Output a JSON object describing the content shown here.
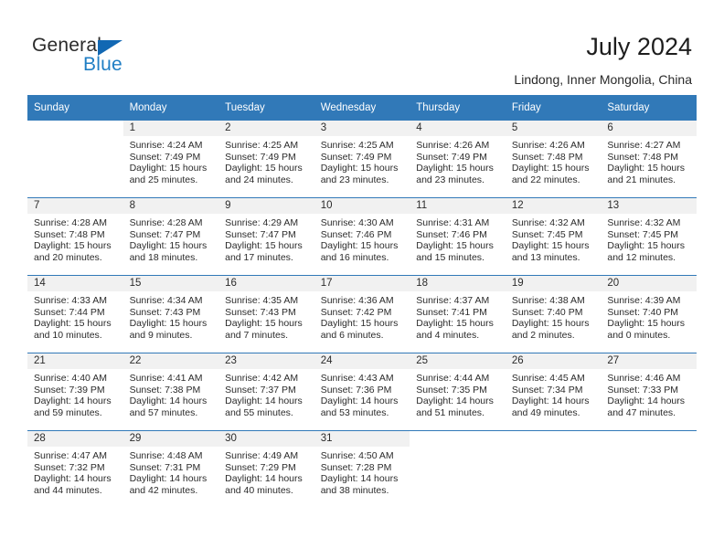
{
  "brand": {
    "name_part1": "General",
    "name_part2": "Blue",
    "triangle_color": "#1268b3",
    "blue_text_color": "#1f7ec4"
  },
  "header": {
    "title": "July 2024",
    "location": "Lindong, Inner Mongolia, China",
    "header_bg_color": "#3179b8"
  },
  "weekdays": [
    "Sunday",
    "Monday",
    "Tuesday",
    "Wednesday",
    "Thursday",
    "Friday",
    "Saturday"
  ],
  "labels": {
    "sunrise_prefix": "Sunrise:",
    "sunset_prefix": "Sunset:",
    "daylight_prefix": "Daylight:"
  },
  "weeks": [
    [
      {
        "day": "",
        "sunrise": "",
        "sunset": "",
        "daylight": "",
        "empty": true
      },
      {
        "day": "1",
        "sunrise": "Sunrise: 4:24 AM",
        "sunset": "Sunset: 7:49 PM",
        "daylight": "Daylight: 15 hours and 25 minutes."
      },
      {
        "day": "2",
        "sunrise": "Sunrise: 4:25 AM",
        "sunset": "Sunset: 7:49 PM",
        "daylight": "Daylight: 15 hours and 24 minutes."
      },
      {
        "day": "3",
        "sunrise": "Sunrise: 4:25 AM",
        "sunset": "Sunset: 7:49 PM",
        "daylight": "Daylight: 15 hours and 23 minutes."
      },
      {
        "day": "4",
        "sunrise": "Sunrise: 4:26 AM",
        "sunset": "Sunset: 7:49 PM",
        "daylight": "Daylight: 15 hours and 23 minutes."
      },
      {
        "day": "5",
        "sunrise": "Sunrise: 4:26 AM",
        "sunset": "Sunset: 7:48 PM",
        "daylight": "Daylight: 15 hours and 22 minutes."
      },
      {
        "day": "6",
        "sunrise": "Sunrise: 4:27 AM",
        "sunset": "Sunset: 7:48 PM",
        "daylight": "Daylight: 15 hours and 21 minutes."
      }
    ],
    [
      {
        "day": "7",
        "sunrise": "Sunrise: 4:28 AM",
        "sunset": "Sunset: 7:48 PM",
        "daylight": "Daylight: 15 hours and 20 minutes."
      },
      {
        "day": "8",
        "sunrise": "Sunrise: 4:28 AM",
        "sunset": "Sunset: 7:47 PM",
        "daylight": "Daylight: 15 hours and 18 minutes."
      },
      {
        "day": "9",
        "sunrise": "Sunrise: 4:29 AM",
        "sunset": "Sunset: 7:47 PM",
        "daylight": "Daylight: 15 hours and 17 minutes."
      },
      {
        "day": "10",
        "sunrise": "Sunrise: 4:30 AM",
        "sunset": "Sunset: 7:46 PM",
        "daylight": "Daylight: 15 hours and 16 minutes."
      },
      {
        "day": "11",
        "sunrise": "Sunrise: 4:31 AM",
        "sunset": "Sunset: 7:46 PM",
        "daylight": "Daylight: 15 hours and 15 minutes."
      },
      {
        "day": "12",
        "sunrise": "Sunrise: 4:32 AM",
        "sunset": "Sunset: 7:45 PM",
        "daylight": "Daylight: 15 hours and 13 minutes."
      },
      {
        "day": "13",
        "sunrise": "Sunrise: 4:32 AM",
        "sunset": "Sunset: 7:45 PM",
        "daylight": "Daylight: 15 hours and 12 minutes."
      }
    ],
    [
      {
        "day": "14",
        "sunrise": "Sunrise: 4:33 AM",
        "sunset": "Sunset: 7:44 PM",
        "daylight": "Daylight: 15 hours and 10 minutes."
      },
      {
        "day": "15",
        "sunrise": "Sunrise: 4:34 AM",
        "sunset": "Sunset: 7:43 PM",
        "daylight": "Daylight: 15 hours and 9 minutes."
      },
      {
        "day": "16",
        "sunrise": "Sunrise: 4:35 AM",
        "sunset": "Sunset: 7:43 PM",
        "daylight": "Daylight: 15 hours and 7 minutes."
      },
      {
        "day": "17",
        "sunrise": "Sunrise: 4:36 AM",
        "sunset": "Sunset: 7:42 PM",
        "daylight": "Daylight: 15 hours and 6 minutes."
      },
      {
        "day": "18",
        "sunrise": "Sunrise: 4:37 AM",
        "sunset": "Sunset: 7:41 PM",
        "daylight": "Daylight: 15 hours and 4 minutes."
      },
      {
        "day": "19",
        "sunrise": "Sunrise: 4:38 AM",
        "sunset": "Sunset: 7:40 PM",
        "daylight": "Daylight: 15 hours and 2 minutes."
      },
      {
        "day": "20",
        "sunrise": "Sunrise: 4:39 AM",
        "sunset": "Sunset: 7:40 PM",
        "daylight": "Daylight: 15 hours and 0 minutes."
      }
    ],
    [
      {
        "day": "21",
        "sunrise": "Sunrise: 4:40 AM",
        "sunset": "Sunset: 7:39 PM",
        "daylight": "Daylight: 14 hours and 59 minutes."
      },
      {
        "day": "22",
        "sunrise": "Sunrise: 4:41 AM",
        "sunset": "Sunset: 7:38 PM",
        "daylight": "Daylight: 14 hours and 57 minutes."
      },
      {
        "day": "23",
        "sunrise": "Sunrise: 4:42 AM",
        "sunset": "Sunset: 7:37 PM",
        "daylight": "Daylight: 14 hours and 55 minutes."
      },
      {
        "day": "24",
        "sunrise": "Sunrise: 4:43 AM",
        "sunset": "Sunset: 7:36 PM",
        "daylight": "Daylight: 14 hours and 53 minutes."
      },
      {
        "day": "25",
        "sunrise": "Sunrise: 4:44 AM",
        "sunset": "Sunset: 7:35 PM",
        "daylight": "Daylight: 14 hours and 51 minutes."
      },
      {
        "day": "26",
        "sunrise": "Sunrise: 4:45 AM",
        "sunset": "Sunset: 7:34 PM",
        "daylight": "Daylight: 14 hours and 49 minutes."
      },
      {
        "day": "27",
        "sunrise": "Sunrise: 4:46 AM",
        "sunset": "Sunset: 7:33 PM",
        "daylight": "Daylight: 14 hours and 47 minutes."
      }
    ],
    [
      {
        "day": "28",
        "sunrise": "Sunrise: 4:47 AM",
        "sunset": "Sunset: 7:32 PM",
        "daylight": "Daylight: 14 hours and 44 minutes."
      },
      {
        "day": "29",
        "sunrise": "Sunrise: 4:48 AM",
        "sunset": "Sunset: 7:31 PM",
        "daylight": "Daylight: 14 hours and 42 minutes."
      },
      {
        "day": "30",
        "sunrise": "Sunrise: 4:49 AM",
        "sunset": "Sunset: 7:29 PM",
        "daylight": "Daylight: 14 hours and 40 minutes."
      },
      {
        "day": "31",
        "sunrise": "Sunrise: 4:50 AM",
        "sunset": "Sunset: 7:28 PM",
        "daylight": "Daylight: 14 hours and 38 minutes."
      },
      {
        "day": "",
        "sunrise": "",
        "sunset": "",
        "daylight": "",
        "empty": true
      },
      {
        "day": "",
        "sunrise": "",
        "sunset": "",
        "daylight": "",
        "empty": true
      },
      {
        "day": "",
        "sunrise": "",
        "sunset": "",
        "daylight": "",
        "empty": true
      }
    ]
  ]
}
